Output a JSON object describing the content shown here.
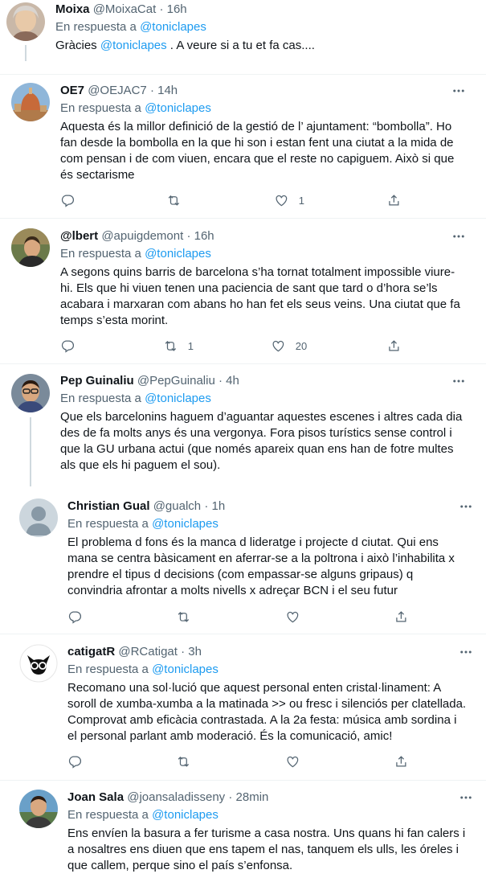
{
  "reply_prefix": "En respuesta a",
  "icons": {
    "reply": "reply-icon",
    "retweet": "retweet-icon",
    "like": "like-icon",
    "share": "share-icon",
    "more": "more-icon"
  },
  "colors": {
    "link": "#1d9bf0",
    "secondary": "#536471",
    "text": "#0f1419"
  },
  "tweets": [
    {
      "name": "Moixa",
      "handle": "@MoixaCat",
      "time": "16h",
      "mention": "@toniclapes",
      "text_before": "Gràcies ",
      "text_mention": "@toniclapes",
      "text_after": " . A veure si a tu et fa cas....",
      "replies": "",
      "retweets": "",
      "likes": ""
    },
    {
      "name": "OE7",
      "handle": "@OEJAC7",
      "time": "14h",
      "mention": "@toniclapes",
      "text": "Aquesta és la millor definició de la gestió de l’ ajuntament: “bombolla”. Ho fan desde la bombolla en la que hi son i estan fent una ciutat a la mida de com pensan i de com viuen, encara que el reste no capiguem. Això si que és sectarisme",
      "replies": "",
      "retweets": "",
      "likes": "1"
    },
    {
      "name": "@lbert",
      "handle": "@apuigdemont",
      "time": "16h",
      "mention": "@toniclapes",
      "text": "A segons quins barris de barcelona s’ha tornat totalment impossible viure-hi. Els que hi viuen tenen una paciencia de sant que tard o d’hora se’ls acabara i marxaran com abans ho han fet els seus veins. Una ciutat que fa temps s’esta morint.",
      "replies": "",
      "retweets": "1",
      "likes": "20"
    },
    {
      "name": "Pep Guinaliu",
      "handle": "@PepGuinaliu",
      "time": "4h",
      "mention": "@toniclapes",
      "text": "Que els barcelonins haguem d’aguantar aquestes escenes i altres cada dia des de fa molts anys és una vergonya. Fora pisos turístics sense control i que la GU urbana actui (que només apareix quan ens han de fotre multes als que els hi paguem el sou).",
      "replies": "",
      "retweets": "",
      "likes": ""
    },
    {
      "name": "Christian Gual",
      "handle": "@gualch",
      "time": "1h",
      "mention": "@toniclapes",
      "text": "El problema d fons és la manca d lideratge i projecte d ciutat. Qui ens mana se centra bàsicament en aferrar-se a la poltrona i això l’inhabilita x prendre el tipus d decisions (com empassar-se alguns gripaus) q convindria afrontar a molts nivells x adreçar BCN i el seu futur",
      "replies": "",
      "retweets": "",
      "likes": ""
    },
    {
      "name": "catigatR",
      "handle": "@RCatigat",
      "time": "3h",
      "mention": "@toniclapes",
      "text": "Recomano una sol·lució que aquest personal enten cristal·linament: A soroll de xumba-xumba a la matinada >> ou fresc i silenciós per clatellada. Comprovat amb eficàcia contrastada. A la 2a festa: música amb sordina i el personal parlant amb moderació. És la comunicació, amic!",
      "replies": "",
      "retweets": "",
      "likes": ""
    },
    {
      "name": "Joan Sala",
      "handle": "@joansaladisseny",
      "time": "28min",
      "mention": "@toniclapes",
      "text": "Ens envíen la basura a fer turisme a casa nostra. Uns quans hi fan calers i a nosaltres ens diuen que ens tapem el nas, tanquem els ulls, les óreles i que callem, perque sino el país s’enfonsa.",
      "replies": "",
      "retweets": "",
      "likes": ""
    }
  ]
}
